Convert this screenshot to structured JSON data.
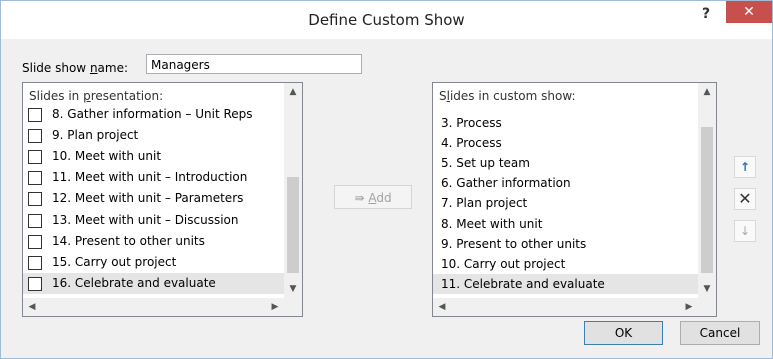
{
  "dialog": {
    "title": "Define Custom Show",
    "help_label": "?",
    "close_label": "✕"
  },
  "name_field": {
    "label_pre": "Slide show ",
    "label_accel": "n",
    "label_post": "ame:",
    "value": "Managers"
  },
  "presentation_list": {
    "header_pre": "Slides in ",
    "header_accel": "p",
    "header_post": "resentation:",
    "items": [
      {
        "label": "8. Gather information – Unit Reps",
        "checked": false,
        "selected": false
      },
      {
        "label": "9. Plan project",
        "checked": false,
        "selected": false
      },
      {
        "label": "10. Meet with unit",
        "checked": false,
        "selected": false
      },
      {
        "label": "11. Meet with unit – Introduction",
        "checked": false,
        "selected": false
      },
      {
        "label": "12. Meet with unit – Parameters",
        "checked": false,
        "selected": false
      },
      {
        "label": "13. Meet with unit – Discussion",
        "checked": false,
        "selected": false
      },
      {
        "label": "14. Present to other units",
        "checked": false,
        "selected": false
      },
      {
        "label": "15. Carry out project",
        "checked": false,
        "selected": false
      },
      {
        "label": "16. Celebrate and evaluate",
        "checked": false,
        "selected": true
      }
    ]
  },
  "add_button": {
    "arrow": "⇛",
    "label_accel": "A",
    "label_post": "dd"
  },
  "custom_list": {
    "header_pre": "S",
    "header_accel": "l",
    "header_post": "ides in custom show:",
    "items": [
      {
        "label": "3. Process",
        "selected": false
      },
      {
        "label": "4. Process",
        "selected": false
      },
      {
        "label": "5. Set up team",
        "selected": false
      },
      {
        "label": "6. Gather information",
        "selected": false
      },
      {
        "label": "7. Plan project",
        "selected": false
      },
      {
        "label": "8. Meet with unit",
        "selected": false
      },
      {
        "label": "9. Present to other units",
        "selected": false
      },
      {
        "label": "10. Carry out project",
        "selected": false
      },
      {
        "label": "11. Celebrate and evaluate",
        "selected": true
      }
    ]
  },
  "side_buttons": {
    "up": "↑",
    "remove": "✕",
    "down": "↓"
  },
  "footer": {
    "ok_label": "OK",
    "cancel_label": "Cancel"
  },
  "colors": {
    "close_button": "#c7504c",
    "up_arrow": "#2f6fb5",
    "selection": "#e5e5e5"
  }
}
